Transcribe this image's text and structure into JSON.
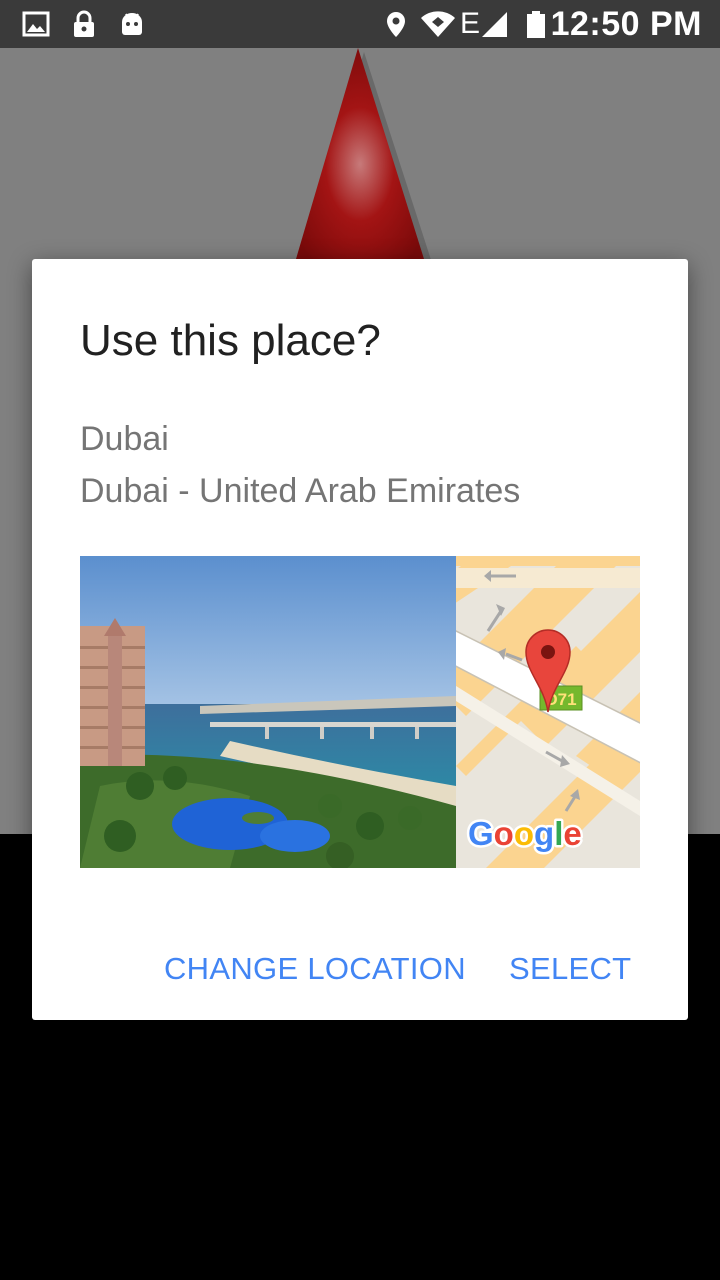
{
  "status_bar": {
    "time": "12:50 PM",
    "network": "E",
    "icons": [
      "image-icon",
      "lock-icon",
      "android-icon",
      "location-icon",
      "wifi-icon",
      "signal-icon",
      "battery-icon"
    ]
  },
  "dialog": {
    "title": "Use this place?",
    "place_name": "Dubai",
    "place_address": "Dubai - United Arab Emirates",
    "map_badge": "D71",
    "map_logo": "Google",
    "buttons": {
      "change_location": "CHANGE LOCATION",
      "select": "SELECT"
    }
  },
  "colors": {
    "accent": "#4285f4",
    "title": "#212121",
    "secondary_text": "#757575",
    "pin": "#e8453c",
    "scrim": "#808080"
  }
}
